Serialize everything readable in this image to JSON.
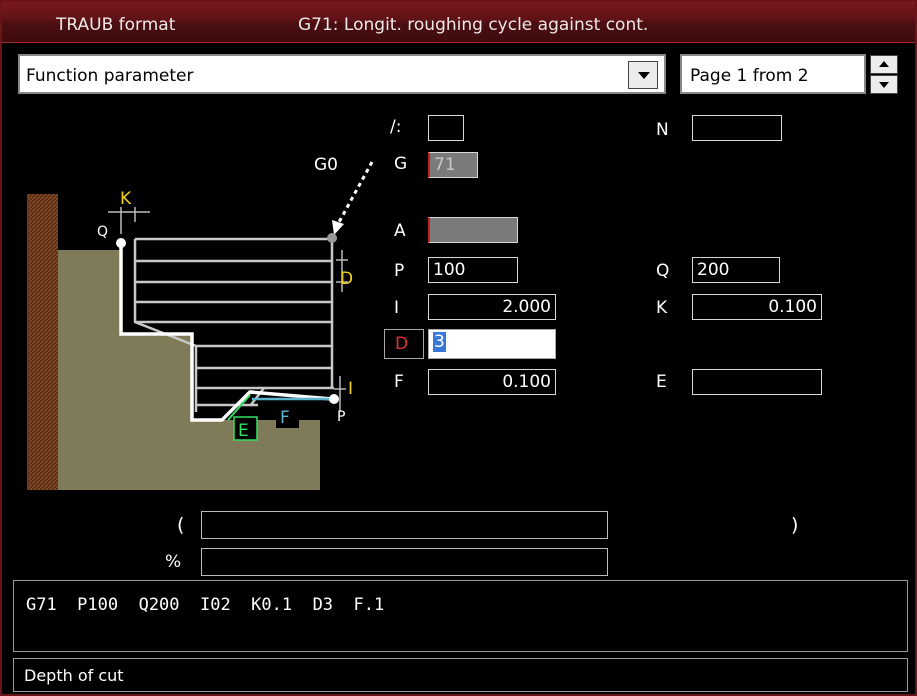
{
  "title": {
    "format": "TRAUB format",
    "cycle": "G71:  Longit. roughing cycle against cont."
  },
  "selector": {
    "function_parameter": "Function parameter",
    "page": "Page 1 from 2"
  },
  "diagram": {
    "labels": {
      "g0": "G0",
      "k": "K",
      "q": "Q",
      "d": "D",
      "i": "I",
      "p": "P",
      "e": "E",
      "f": "F"
    },
    "colors": {
      "workpiece": "#7f7b58",
      "chuck": "#6b3a1c",
      "contour": "#ffffff",
      "cuts": "#c8c8c8",
      "finish": "#5ab4d0",
      "label_yellow": "#f0d020",
      "label_green": "#30e060"
    }
  },
  "params": {
    "slash": {
      "label": "/:",
      "value": ""
    },
    "n": {
      "label": "N",
      "value": ""
    },
    "g": {
      "label": "G",
      "value": "71"
    },
    "a": {
      "label": "A",
      "value": ""
    },
    "p": {
      "label": "P",
      "value": "100"
    },
    "q": {
      "label": "Q",
      "value": "200"
    },
    "i": {
      "label": "I",
      "value": "2.000"
    },
    "k": {
      "label": "K",
      "value": "0.100"
    },
    "d": {
      "label": "D",
      "value": "3"
    },
    "f": {
      "label": "F",
      "value": "0.100"
    },
    "e": {
      "label": "E",
      "value": ""
    }
  },
  "comment": {
    "open_paren": "(",
    "close_paren": ")",
    "percent": "%",
    "text": "",
    "percent_value": ""
  },
  "code": "G71  P100  Q200  I02  K0.1  D3  F.1",
  "status": "Depth of cut"
}
